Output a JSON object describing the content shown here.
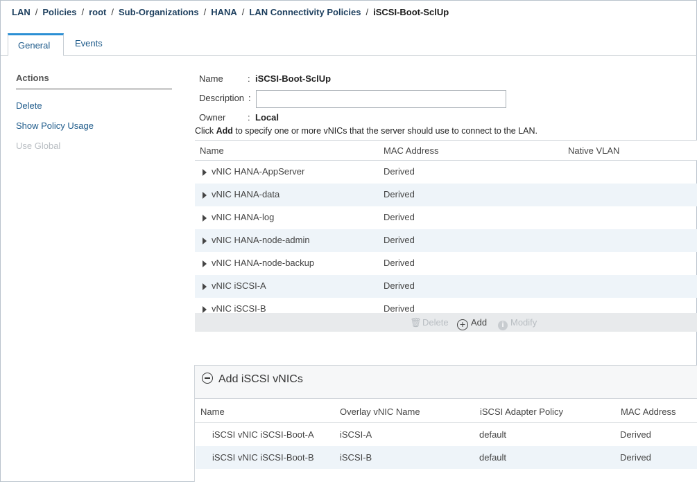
{
  "breadcrumb": [
    "LAN",
    "Policies",
    "root",
    "Sub-Organizations",
    "HANA",
    "LAN Connectivity Policies",
    "iSCSI-Boot-SclUp"
  ],
  "tabs": [
    {
      "label": "General",
      "active": true
    },
    {
      "label": "Events",
      "active": false
    }
  ],
  "actions": {
    "title": "Actions",
    "items": [
      {
        "label": "Delete",
        "enabled": true
      },
      {
        "label": "Show Policy Usage",
        "enabled": true
      },
      {
        "label": "Use Global",
        "enabled": false
      }
    ]
  },
  "properties": {
    "name_label": "Name",
    "name_value": "iSCSI-Boot-SclUp",
    "description_label": "Description",
    "description_value": "",
    "owner_label": "Owner",
    "owner_value": "Local",
    "colon": ":"
  },
  "hint": {
    "before": "Click ",
    "keyword": "Add",
    "after": " to specify one or more vNICs that the server should use to connect to the LAN."
  },
  "vnic_table": {
    "columns": [
      "Name",
      "MAC Address",
      "Native VLAN"
    ],
    "rows": [
      {
        "name": "vNIC HANA-AppServer",
        "mac": "Derived"
      },
      {
        "name": "vNIC HANA-data",
        "mac": "Derived"
      },
      {
        "name": "vNIC HANA-log",
        "mac": "Derived"
      },
      {
        "name": "vNIC HANA-node-admin",
        "mac": "Derived"
      },
      {
        "name": "vNIC HANA-node-backup",
        "mac": "Derived"
      },
      {
        "name": "vNIC iSCSI-A",
        "mac": "Derived"
      },
      {
        "name": "vNIC iSCSI-B",
        "mac": "Derived"
      }
    ]
  },
  "toolbar": {
    "delete_label": "Delete",
    "add_label": "Add",
    "modify_label": "Modify"
  },
  "iscsi_panel": {
    "title": "Add iSCSI vNICs",
    "columns": [
      "Name",
      "Overlay vNIC Name",
      "iSCSI Adapter Policy",
      "MAC Address"
    ],
    "rows": [
      {
        "name": "iSCSI vNIC iSCSI-Boot-A",
        "overlay": "iSCSI-A",
        "policy": "default",
        "mac": "Derived"
      },
      {
        "name": "iSCSI vNIC iSCSI-Boot-B",
        "overlay": "iSCSI-B",
        "policy": "default",
        "mac": "Derived"
      }
    ]
  },
  "colors": {
    "link": "#1d5a8a",
    "tab_accent": "#2b8fd4",
    "row_alt": "#eef4f9",
    "disabled": "#b8bdc2"
  }
}
